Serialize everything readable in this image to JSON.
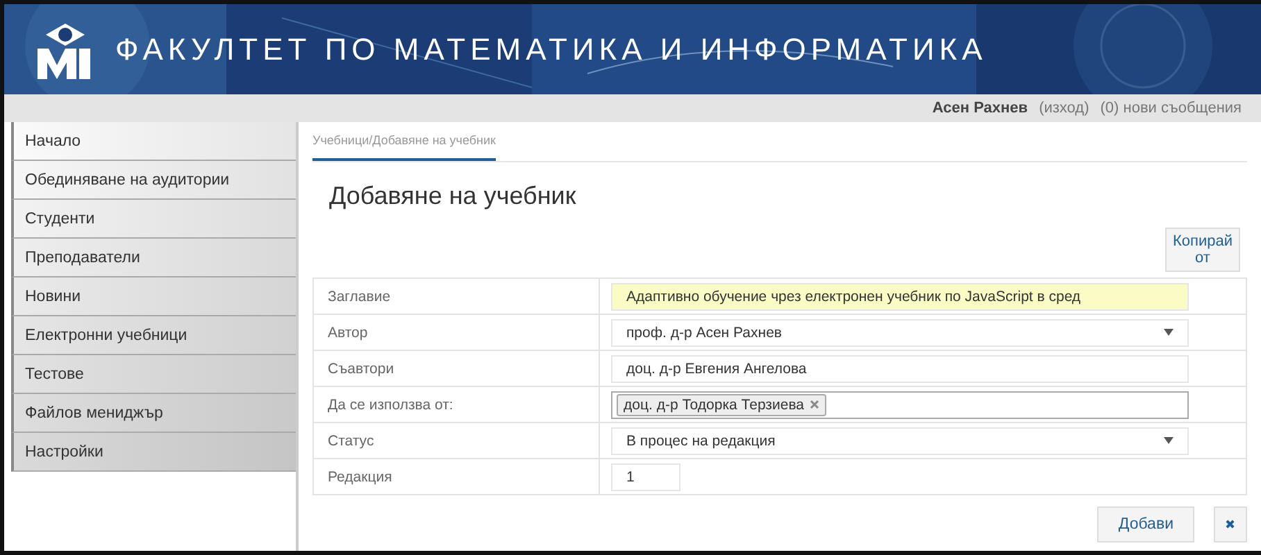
{
  "header": {
    "title": "ФАКУЛТЕТ ПО МАТЕМАТИКА И ИНФОРМАТИКА"
  },
  "user_bar": {
    "user": "Асен Рахнев",
    "logout": "(изход)",
    "messages": "(0) нови съобщения"
  },
  "sidebar": {
    "items": [
      {
        "label": "Начало"
      },
      {
        "label": "Обединяване на аудитории"
      },
      {
        "label": "Студенти"
      },
      {
        "label": "Преподаватели"
      },
      {
        "label": "Новини"
      },
      {
        "label": "Електронни учебници"
      },
      {
        "label": "Тестове"
      },
      {
        "label": "Файлов мениджър"
      },
      {
        "label": "Настройки"
      }
    ]
  },
  "breadcrumb": "Учебници/Добавяне на учебник",
  "page_title": "Добавяне на учебник",
  "copy_button": "Копирай от",
  "form": [
    {
      "label": "Заглавие",
      "kind": "text",
      "value": "Адаптивно обучение чрез електронен учебник по JavaScript в сред",
      "highlighted": true
    },
    {
      "label": "Автор",
      "kind": "select",
      "value": "проф. д-р Асен Рахнев"
    },
    {
      "label": "Съавтори",
      "kind": "text",
      "value": "доц. д-р Евгения Ангелова",
      "highlighted": false
    },
    {
      "label": "Да се използва от:",
      "kind": "tags",
      "tags": [
        "доц. д-р Тодорка Терзиева"
      ]
    },
    {
      "label": "Статус",
      "kind": "select",
      "value": "В процес на редакция"
    },
    {
      "label": "Редакция",
      "kind": "number",
      "value": "1"
    }
  ],
  "buttons": {
    "submit": "Добави",
    "cancel": "✖"
  }
}
